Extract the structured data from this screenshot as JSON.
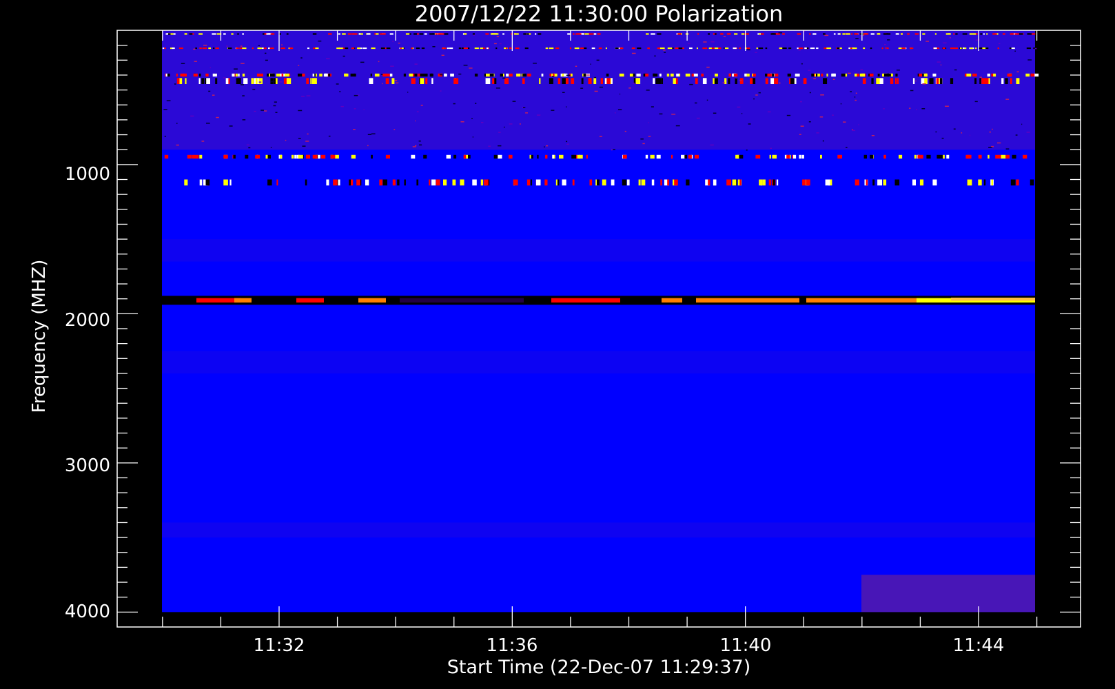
{
  "chart_data": {
    "type": "heatmap",
    "title": "2007/12/22 11:30:00 Polarization",
    "xlabel": "Start Time (22-Dec-07 11:29:37)",
    "ylabel": "Frequency (MHZ)",
    "x_tick_labels": [
      "11:32",
      "11:36",
      "11:40",
      "11:44"
    ],
    "y_tick_labels": [
      "1000",
      "2000",
      "3000",
      "4000"
    ],
    "y_ticks": [
      1000,
      2000,
      3000,
      4000
    ],
    "y_axis_inverted": true,
    "ylim": [
      100,
      4100
    ],
    "data_ylim": [
      100,
      4000
    ],
    "colormap": [
      "#000000",
      "#0000ff",
      "#ff0000",
      "#ff8000",
      "#ffff00",
      "#ffffff"
    ],
    "background": "#0000ff",
    "axis_color": "#ffffff",
    "bands": [
      {
        "freq_range": [
          120,
          130
        ],
        "style": "speckle",
        "intensity": "high"
      },
      {
        "freq_range": [
          215,
          225
        ],
        "style": "speckle",
        "intensity": "high"
      },
      {
        "freq_range": [
          390,
          410
        ],
        "style": "speckle",
        "intensity": "high"
      },
      {
        "freq_range": [
          420,
          460
        ],
        "style": "speckle",
        "intensity": "medium"
      },
      {
        "freq_range": [
          100,
          900
        ],
        "style": "noise",
        "intensity": "medium"
      },
      {
        "freq_range": [
          935,
          960
        ],
        "style": "speckle",
        "intensity": "medium"
      },
      {
        "freq_range": [
          1100,
          1140
        ],
        "style": "speckle",
        "intensity": "medium"
      },
      {
        "freq_range": [
          1880,
          1940
        ],
        "style": "burst",
        "intensity": "high"
      }
    ]
  }
}
